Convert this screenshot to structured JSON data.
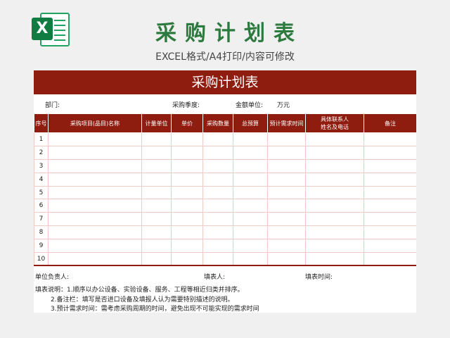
{
  "header": {
    "title": "采购计划表",
    "subtitle": "EXCEL格式/A4打印/内容可修改",
    "logo_letter": "X"
  },
  "sheet": {
    "banner": "采购计划表",
    "info": {
      "dept": "部门:",
      "season": "采购季度:",
      "amount_unit": "金额单位:",
      "amount_value": "万元"
    },
    "columns": [
      "序号",
      "采购项目(品目)名称",
      "计量单位",
      "单价",
      "采购数量",
      "总预算",
      "预计需求时间",
      "具体联系人\n姓名及电话",
      "备注"
    ],
    "rows": [
      "1",
      "2",
      "3",
      "4",
      "5",
      "6",
      "7",
      "8",
      "9",
      "10"
    ],
    "footer": {
      "responsible": "单位负责人:",
      "filler": "填表人:",
      "fill_time": "填表时间:"
    },
    "notes": [
      "填表说明：1.顺序以办公设备、实验设备、服务、工程等相近归类并排序。",
      "2.备注栏：填写是否进口设备及填报人认为需要特别描述的说明。",
      "3.预计需求时间：需考虑采购周期的时间，避免出现不可能实现的需求时间"
    ]
  },
  "colors": {
    "brand_red": "#8e1c0f",
    "title_green": "#2d7a3e",
    "excel_green": "#107c41"
  }
}
